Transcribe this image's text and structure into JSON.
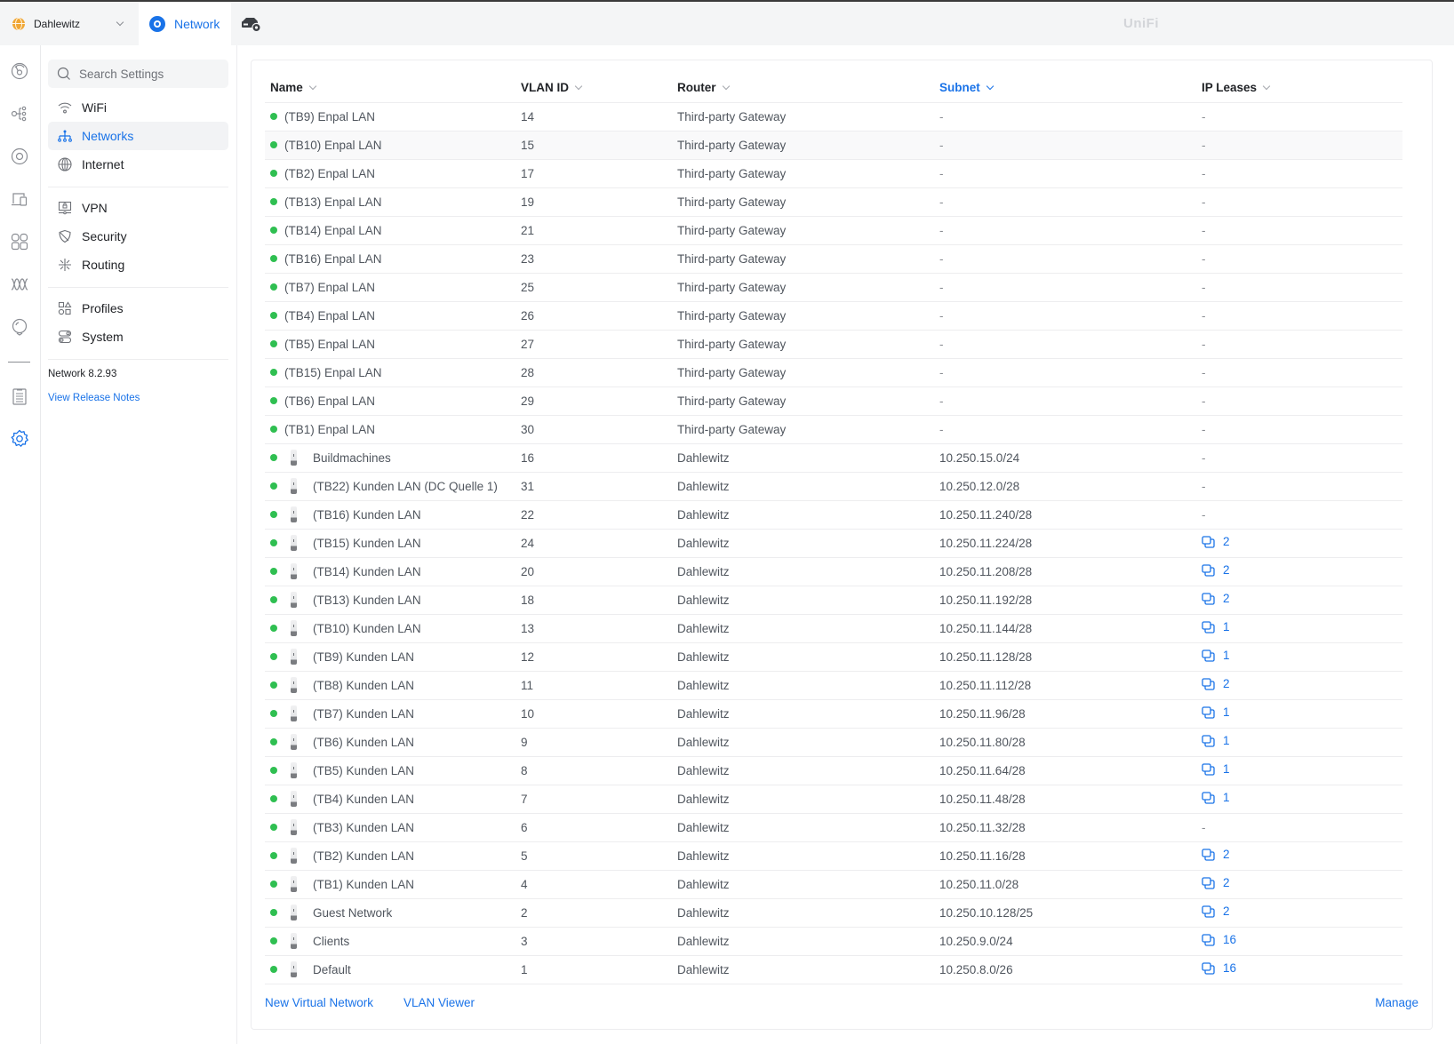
{
  "topbar": {
    "site_name": "Dahlewitz",
    "app_tab": "Network",
    "brand": "UniFi"
  },
  "rail": {
    "icons": [
      "dashboard-icon",
      "topology-icon",
      "devices-icon",
      "clients-icon",
      "ports-icon",
      "insights-icon",
      "innerspace-icon",
      "logs-icon",
      "settings-icon"
    ]
  },
  "sidebar": {
    "search_placeholder": "Search Settings",
    "groups": [
      [
        {
          "label": "WiFi",
          "icon": "wifi-icon"
        },
        {
          "label": "Networks",
          "icon": "networks-icon",
          "active": true
        },
        {
          "label": "Internet",
          "icon": "globe-icon"
        }
      ],
      [
        {
          "label": "VPN",
          "icon": "vpn-icon"
        },
        {
          "label": "Security",
          "icon": "shield-icon"
        },
        {
          "label": "Routing",
          "icon": "routing-icon"
        }
      ],
      [
        {
          "label": "Profiles",
          "icon": "profiles-icon"
        },
        {
          "label": "System",
          "icon": "system-icon"
        }
      ]
    ],
    "version": "Network 8.2.93",
    "release_notes": "View Release Notes"
  },
  "table": {
    "columns": [
      {
        "label": "Name",
        "sorted": false
      },
      {
        "label": "VLAN ID",
        "sorted": false
      },
      {
        "label": "Router",
        "sorted": false
      },
      {
        "label": "Subnet",
        "sorted": true
      },
      {
        "label": "IP Leases",
        "sorted": false
      }
    ],
    "rows": [
      {
        "name": "(TB9) Enpal LAN",
        "vlan": "14",
        "router": "Third-party Gateway",
        "subnet": "-",
        "leases": "-",
        "device": false
      },
      {
        "name": "(TB10) Enpal LAN",
        "vlan": "15",
        "router": "Third-party Gateway",
        "subnet": "-",
        "leases": "-",
        "device": false,
        "hover": true
      },
      {
        "name": "(TB2) Enpal LAN",
        "vlan": "17",
        "router": "Third-party Gateway",
        "subnet": "-",
        "leases": "-",
        "device": false
      },
      {
        "name": "(TB13) Enpal LAN",
        "vlan": "19",
        "router": "Third-party Gateway",
        "subnet": "-",
        "leases": "-",
        "device": false
      },
      {
        "name": "(TB14) Enpal LAN",
        "vlan": "21",
        "router": "Third-party Gateway",
        "subnet": "-",
        "leases": "-",
        "device": false
      },
      {
        "name": "(TB16) Enpal LAN",
        "vlan": "23",
        "router": "Third-party Gateway",
        "subnet": "-",
        "leases": "-",
        "device": false
      },
      {
        "name": "(TB7) Enpal LAN",
        "vlan": "25",
        "router": "Third-party Gateway",
        "subnet": "-",
        "leases": "-",
        "device": false
      },
      {
        "name": "(TB4) Enpal LAN",
        "vlan": "26",
        "router": "Third-party Gateway",
        "subnet": "-",
        "leases": "-",
        "device": false
      },
      {
        "name": "(TB5) Enpal LAN",
        "vlan": "27",
        "router": "Third-party Gateway",
        "subnet": "-",
        "leases": "-",
        "device": false
      },
      {
        "name": "(TB15) Enpal LAN",
        "vlan": "28",
        "router": "Third-party Gateway",
        "subnet": "-",
        "leases": "-",
        "device": false
      },
      {
        "name": "(TB6) Enpal LAN",
        "vlan": "29",
        "router": "Third-party Gateway",
        "subnet": "-",
        "leases": "-",
        "device": false
      },
      {
        "name": "(TB1) Enpal LAN",
        "vlan": "30",
        "router": "Third-party Gateway",
        "subnet": "-",
        "leases": "-",
        "device": false
      },
      {
        "name": "Buildmachines",
        "vlan": "16",
        "router": "Dahlewitz",
        "subnet": "10.250.15.0/24",
        "leases": "-",
        "device": true
      },
      {
        "name": "(TB22) Kunden LAN (DC Quelle 1)",
        "vlan": "31",
        "router": "Dahlewitz",
        "subnet": "10.250.12.0/28",
        "leases": "-",
        "device": true
      },
      {
        "name": "(TB16) Kunden LAN",
        "vlan": "22",
        "router": "Dahlewitz",
        "subnet": "10.250.11.240/28",
        "leases": "-",
        "device": true
      },
      {
        "name": "(TB15) Kunden LAN",
        "vlan": "24",
        "router": "Dahlewitz",
        "subnet": "10.250.11.224/28",
        "leases": "2",
        "device": true
      },
      {
        "name": "(TB14) Kunden LAN",
        "vlan": "20",
        "router": "Dahlewitz",
        "subnet": "10.250.11.208/28",
        "leases": "2",
        "device": true
      },
      {
        "name": "(TB13) Kunden LAN",
        "vlan": "18",
        "router": "Dahlewitz",
        "subnet": "10.250.11.192/28",
        "leases": "2",
        "device": true
      },
      {
        "name": "(TB10) Kunden LAN",
        "vlan": "13",
        "router": "Dahlewitz",
        "subnet": "10.250.11.144/28",
        "leases": "1",
        "device": true
      },
      {
        "name": "(TB9) Kunden LAN",
        "vlan": "12",
        "router": "Dahlewitz",
        "subnet": "10.250.11.128/28",
        "leases": "1",
        "device": true
      },
      {
        "name": "(TB8) Kunden LAN",
        "vlan": "11",
        "router": "Dahlewitz",
        "subnet": "10.250.11.112/28",
        "leases": "2",
        "device": true
      },
      {
        "name": "(TB7) Kunden LAN",
        "vlan": "10",
        "router": "Dahlewitz",
        "subnet": "10.250.11.96/28",
        "leases": "1",
        "device": true
      },
      {
        "name": "(TB6) Kunden LAN",
        "vlan": "9",
        "router": "Dahlewitz",
        "subnet": "10.250.11.80/28",
        "leases": "1",
        "device": true
      },
      {
        "name": "(TB5) Kunden LAN",
        "vlan": "8",
        "router": "Dahlewitz",
        "subnet": "10.250.11.64/28",
        "leases": "1",
        "device": true
      },
      {
        "name": "(TB4) Kunden LAN",
        "vlan": "7",
        "router": "Dahlewitz",
        "subnet": "10.250.11.48/28",
        "leases": "1",
        "device": true
      },
      {
        "name": "(TB3) Kunden LAN",
        "vlan": "6",
        "router": "Dahlewitz",
        "subnet": "10.250.11.32/28",
        "leases": "-",
        "device": true
      },
      {
        "name": "(TB2) Kunden LAN",
        "vlan": "5",
        "router": "Dahlewitz",
        "subnet": "10.250.11.16/28",
        "leases": "2",
        "device": true
      },
      {
        "name": "(TB1) Kunden LAN",
        "vlan": "4",
        "router": "Dahlewitz",
        "subnet": "10.250.11.0/28",
        "leases": "2",
        "device": true
      },
      {
        "name": "Guest Network",
        "vlan": "2",
        "router": "Dahlewitz",
        "subnet": "10.250.10.128/25",
        "leases": "2",
        "device": true
      },
      {
        "name": "Clients",
        "vlan": "3",
        "router": "Dahlewitz",
        "subnet": "10.250.9.0/24",
        "leases": "16",
        "device": true
      },
      {
        "name": "Default",
        "vlan": "1",
        "router": "Dahlewitz",
        "subnet": "10.250.8.0/26",
        "leases": "16",
        "device": true
      }
    ]
  },
  "footer": {
    "new_virtual_network": "New Virtual Network",
    "vlan_viewer": "VLAN Viewer",
    "manage": "Manage"
  },
  "colors": {
    "accent": "#1a73e8",
    "status_online": "#2fbf51",
    "site_globe": "#f0a735"
  }
}
